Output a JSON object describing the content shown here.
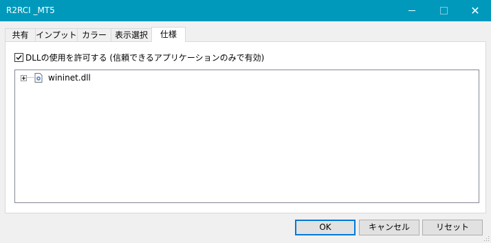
{
  "window": {
    "title": "R2RCI _MT5",
    "title_color": "#0099bc"
  },
  "tabs": [
    {
      "label": "共有",
      "active": false
    },
    {
      "label": "インプット",
      "active": false
    },
    {
      "label": "カラー",
      "active": false
    },
    {
      "label": "表示選択",
      "active": false
    },
    {
      "label": "仕様",
      "active": true
    }
  ],
  "dependencies": {
    "allow_dll_label": "DLLの使用を許可する (信頼できるアプリケーションのみで有効)",
    "allow_dll_checked": true,
    "tree_items": [
      {
        "label": "wininet.dll",
        "icon": "dll-file-icon",
        "expandable": true
      }
    ]
  },
  "buttons": {
    "ok": "OK",
    "cancel": "キャンセル",
    "reset": "リセット"
  }
}
